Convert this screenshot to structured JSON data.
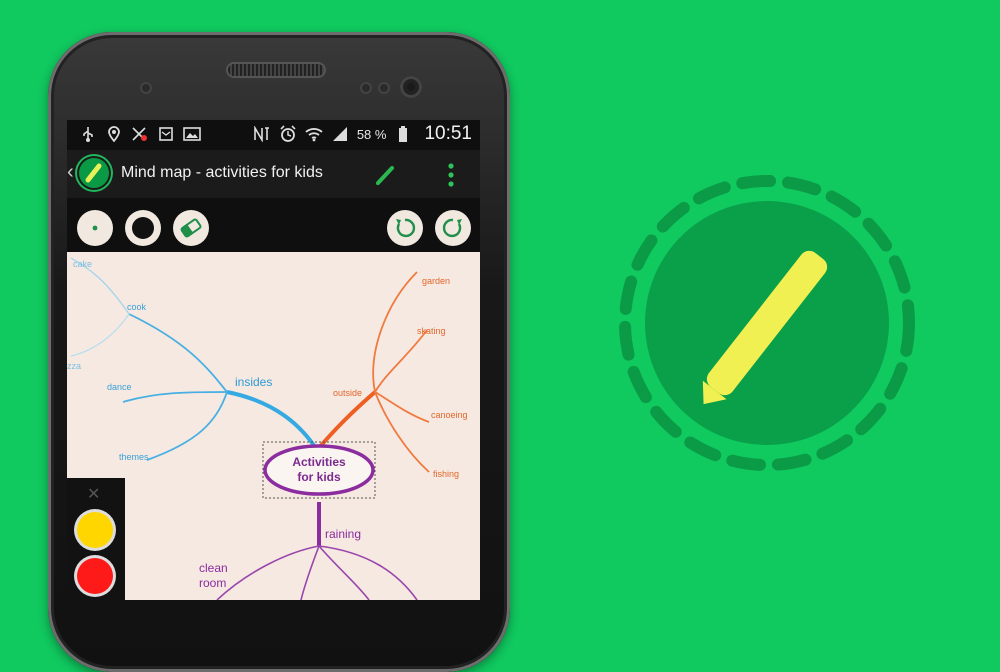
{
  "status_bar": {
    "battery_percent": "58 %",
    "time": "10:51"
  },
  "app_bar": {
    "title": "Mind map - activities for kids",
    "icons": [
      "back-chevron-icon",
      "app-logo-icon",
      "pencil-icon",
      "overflow-menu-icon"
    ]
  },
  "toolbar": {
    "tools": [
      "small-dot-brush",
      "large-dot-brush",
      "eraser",
      "undo",
      "redo"
    ]
  },
  "mindmap": {
    "central": "Activities\nfor kids",
    "nodes": {
      "cake": "cake",
      "cook": "cook",
      "pizza": "zza",
      "dance": "dance",
      "themes": "themes",
      "insides": "insides",
      "garden": "garden",
      "skating": "skating",
      "outside": "outside",
      "canoeing": "canoeing",
      "fishing": "fishing",
      "raining": "raining",
      "clean_room": "clean\nroom"
    }
  },
  "palette": {
    "colors": [
      "#ffd600",
      "#ff1a1a"
    ]
  },
  "colors": {
    "background": "#10c95f",
    "blue_branch": "#3aa9e0",
    "orange_branch": "#ee6a2c",
    "purple_branch": "#8b2c9f",
    "pencil_yellow": "#f1f052",
    "icon_disc": "#0aa04a"
  }
}
